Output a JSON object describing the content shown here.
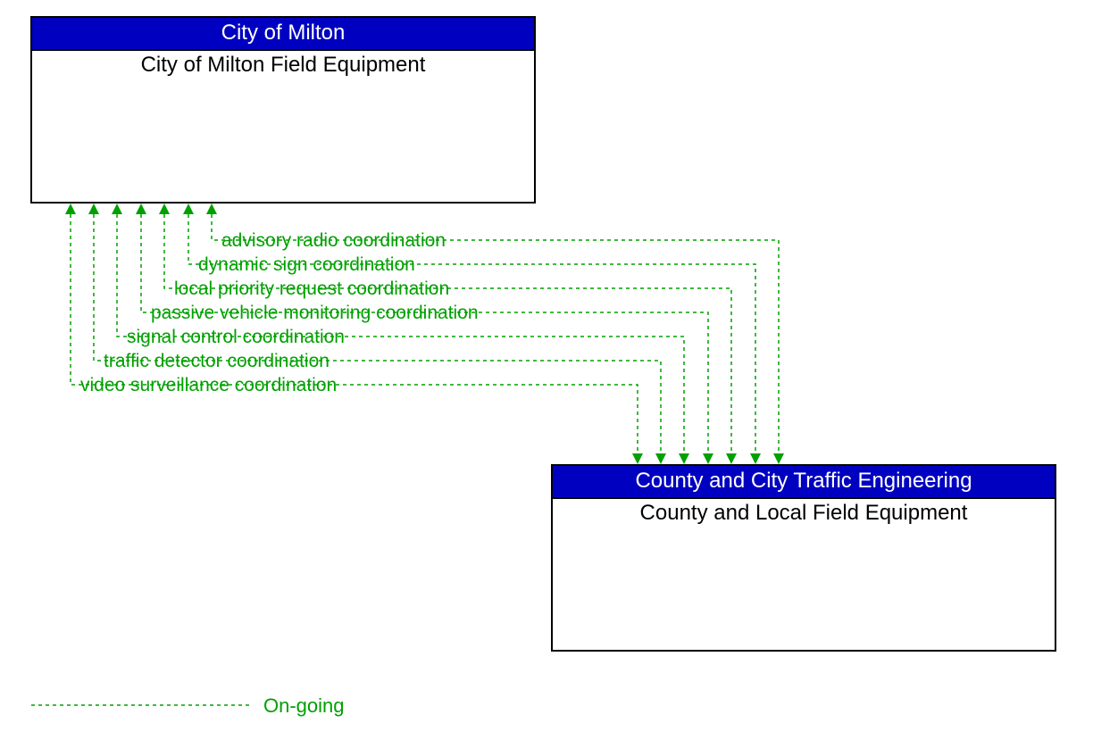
{
  "boxes": {
    "top": {
      "header": "City of Milton",
      "body": "City of Milton Field Equipment"
    },
    "bottom": {
      "header": "County and City Traffic Engineering",
      "body": "County and Local Field Equipment"
    }
  },
  "flows": [
    {
      "label": "advisory radio coordination"
    },
    {
      "label": "dynamic sign coordination"
    },
    {
      "label": "local priority request coordination"
    },
    {
      "label": "passive vehicle monitoring coordination"
    },
    {
      "label": "signal control coordination"
    },
    {
      "label": "traffic detector coordination"
    },
    {
      "label": "video surveillance coordination"
    }
  ],
  "legend": {
    "ongoing": "On-going"
  },
  "colors": {
    "header_bg": "#0000c0",
    "flow": "#00a000"
  }
}
